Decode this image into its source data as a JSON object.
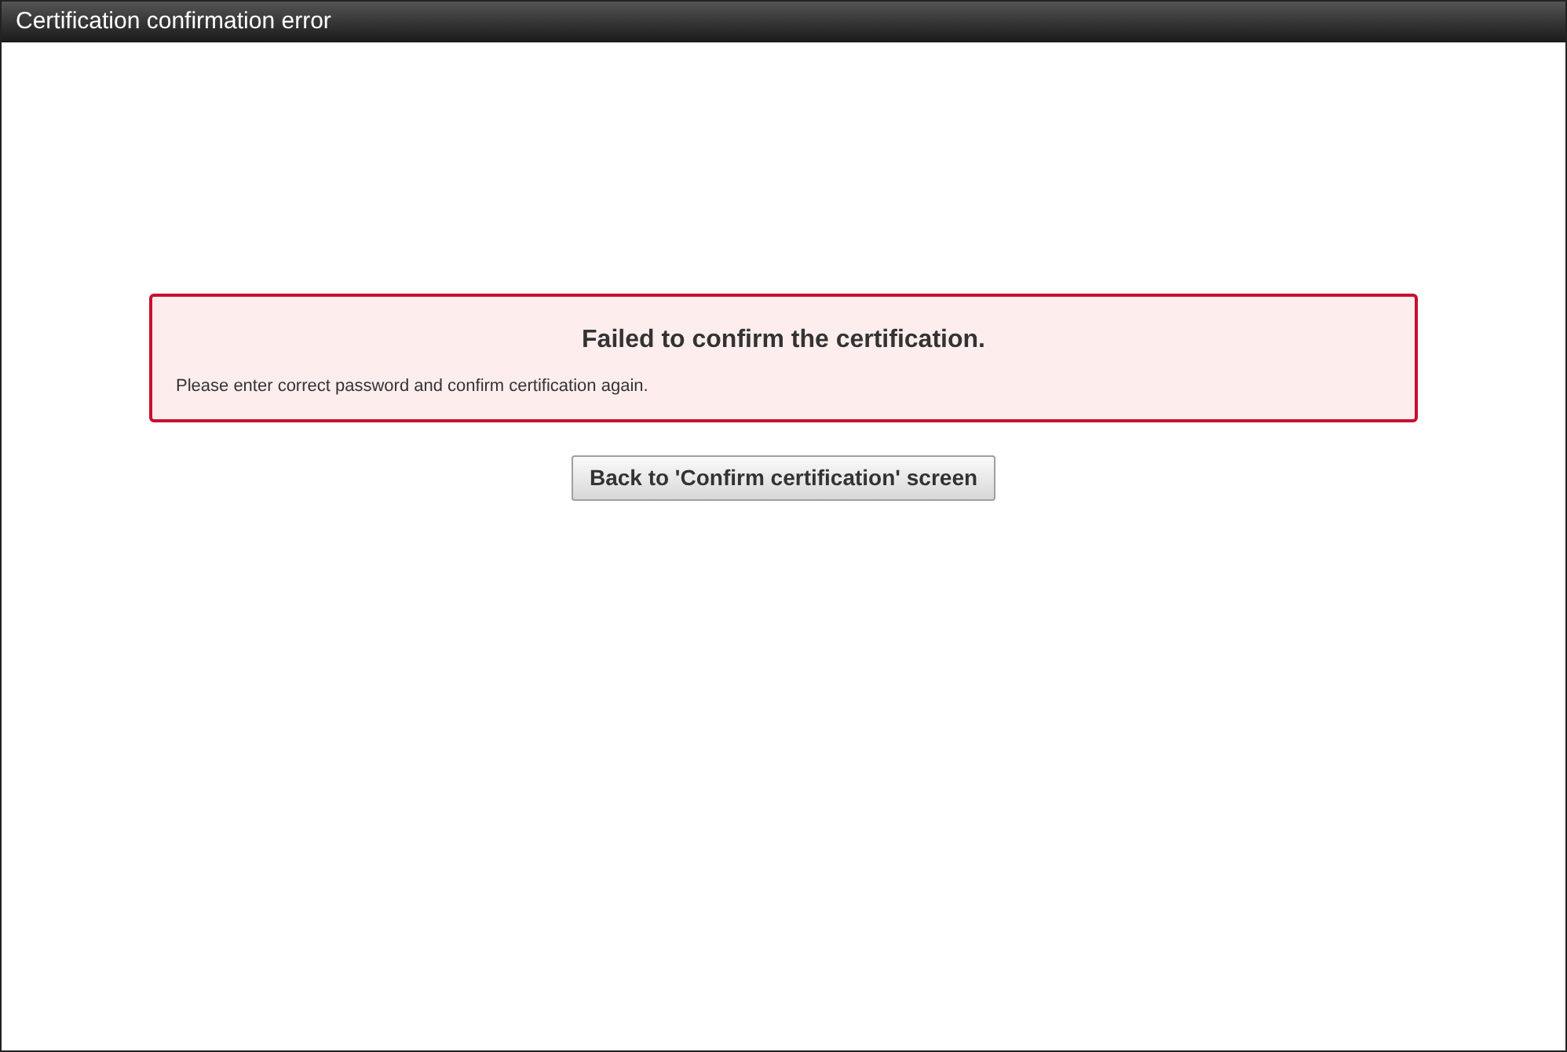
{
  "window": {
    "title": "Certification confirmation error"
  },
  "error": {
    "heading": "Failed to confirm the certification.",
    "message": "Please enter correct password and confirm certification again."
  },
  "buttons": [
    {
      "label": "Back to 'Confirm certification' screen"
    }
  ]
}
